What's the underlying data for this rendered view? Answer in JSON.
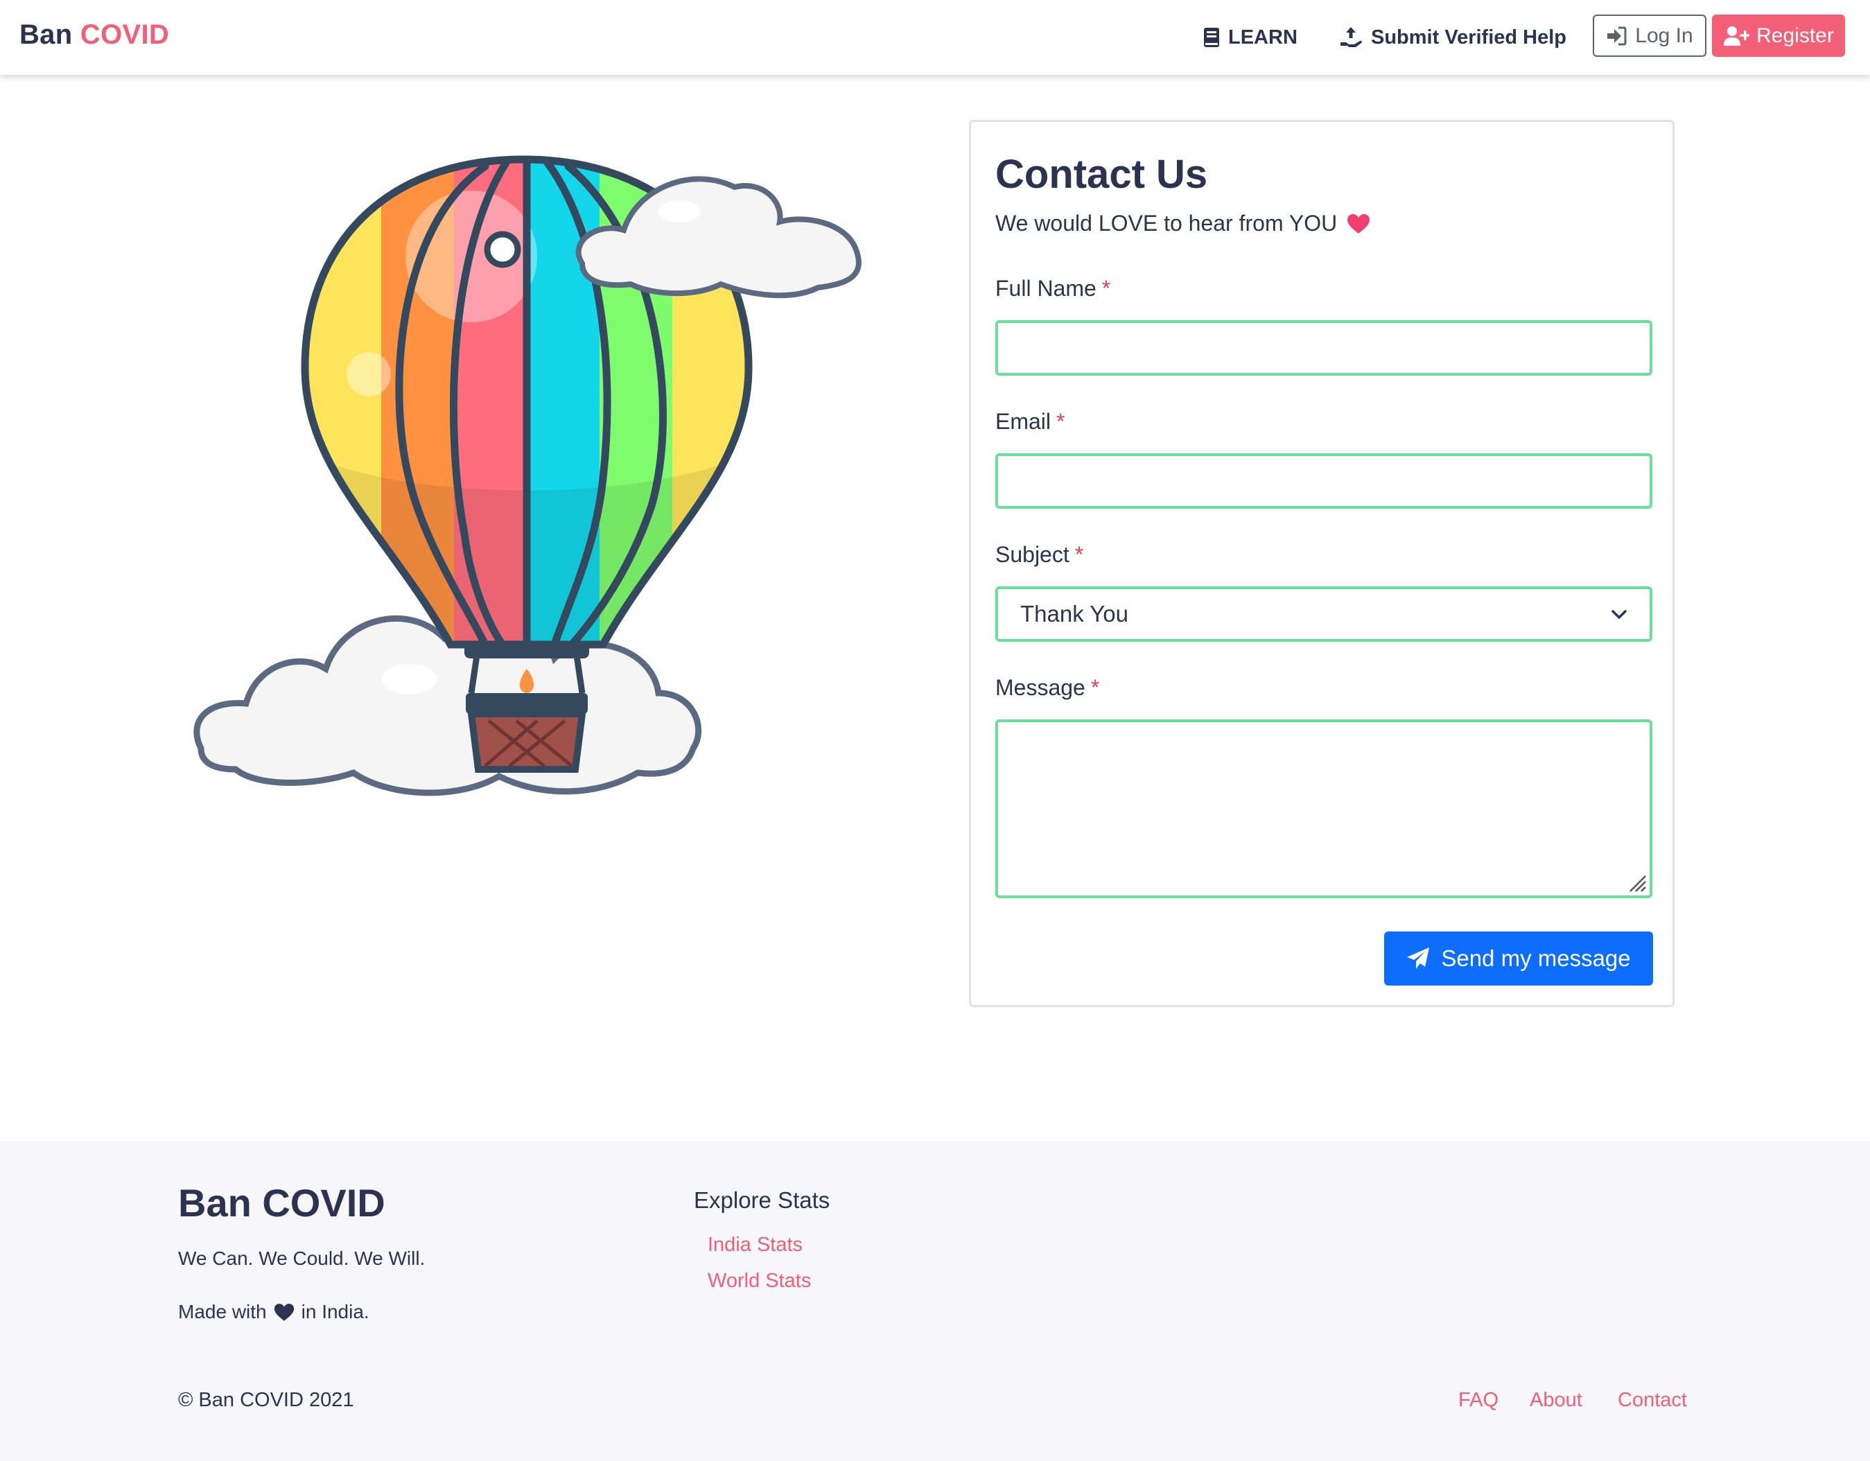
{
  "navbar": {
    "brand_part1": "Ban",
    "brand_part2": "COVID",
    "learn_label": "LEARN",
    "submit_label": "Submit Verified Help",
    "login_label": "Log In",
    "register_label": "Register"
  },
  "contact": {
    "title": "Contact Us",
    "subtitle": "We would LOVE to hear from YOU",
    "full_name_label": "Full Name",
    "email_label": "Email",
    "subject_label": "Subject",
    "subject_value": "Thank You",
    "message_label": "Message",
    "required_mark": "*",
    "full_name_value": "",
    "email_value": "",
    "message_value": "",
    "send_label": "Send my message"
  },
  "footer": {
    "brand": "Ban COVID",
    "tagline": "We Can. We Could. We Will.",
    "made_prefix": "Made with",
    "made_suffix": "in India.",
    "explore_heading": "Explore Stats",
    "india_stats": "India Stats",
    "world_stats": "World Stats",
    "copyright": "© Ban COVID 2021",
    "faq": "FAQ",
    "about": "About",
    "contact": "Contact"
  },
  "colors": {
    "accent_pink": "#f25f76",
    "primary_blue": "#0d6efd",
    "valid_green": "#6bdd9c",
    "text_dark": "#2b3350"
  }
}
